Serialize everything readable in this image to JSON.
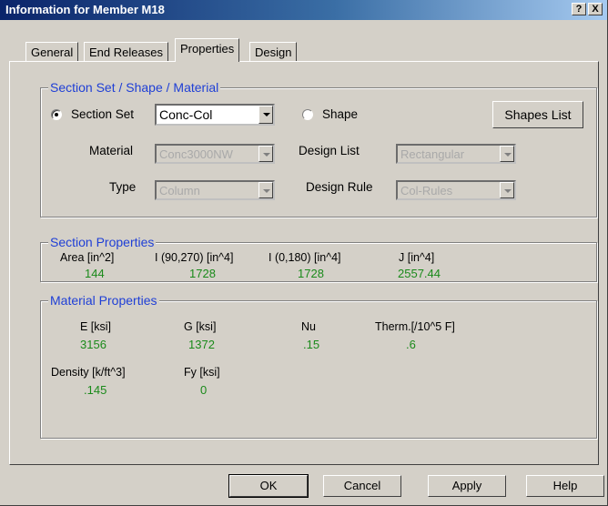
{
  "window": {
    "title": "Information for Member M18",
    "help_btn": "?",
    "close_btn": "X"
  },
  "tabs": [
    "General",
    "End Releases",
    "Properties",
    "Design"
  ],
  "section_set_group": {
    "label": "Section Set / Shape / Material",
    "section_set_label": "Section Set",
    "section_set_value": "Conc-Col",
    "shape_label": "Shape",
    "shapes_list_button": "Shapes List",
    "material_label": "Material",
    "material_value": "Conc3000NW",
    "type_label": "Type",
    "type_value": "Column",
    "design_list_label": "Design List",
    "design_list_value": "Rectangular",
    "design_rule_label": "Design Rule",
    "design_rule_value": "Col-Rules"
  },
  "section_props": {
    "label": "Section Properties",
    "headers": [
      "Area [in^2]",
      "I (90,270) [in^4]",
      "I (0,180) [in^4]",
      "J [in^4]"
    ],
    "values": [
      "144",
      "1728",
      "1728",
      "2557.44"
    ]
  },
  "material_props": {
    "label": "Material Properties",
    "headers_row1": [
      "E [ksi]",
      "G [ksi]",
      "Nu",
      "Therm.[/10^5 F]"
    ],
    "values_row1": [
      "3156",
      "1372",
      ".15",
      ".6"
    ],
    "headers_row2": [
      "Density [k/ft^3]",
      "Fy [ksi]"
    ],
    "values_row2": [
      ".145",
      "0"
    ]
  },
  "buttons": {
    "ok": "OK",
    "cancel": "Cancel",
    "apply": "Apply",
    "help": "Help"
  },
  "colors": {
    "group_label": "#1f3fd6",
    "values": "#1a8a1a",
    "titlebar_start": "#0a246a"
  }
}
